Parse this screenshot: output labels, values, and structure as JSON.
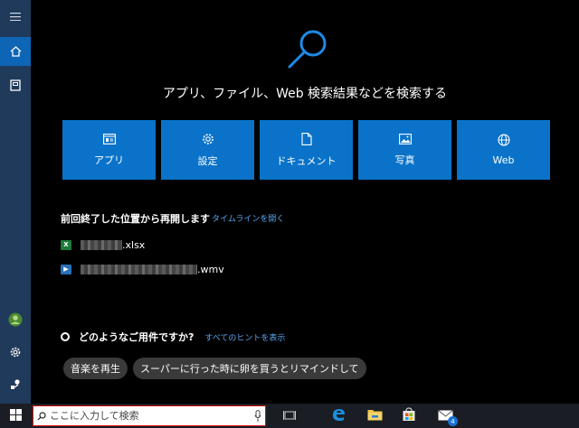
{
  "hero": {
    "text": "アプリ、ファイル、Web 検索結果などを検索する"
  },
  "tiles": [
    {
      "label": "アプリ",
      "icon": "app-window-icon"
    },
    {
      "label": "設定",
      "icon": "gear-icon"
    },
    {
      "label": "ドキュメント",
      "icon": "document-icon"
    },
    {
      "label": "写真",
      "icon": "image-icon"
    },
    {
      "label": "Web",
      "icon": "globe-icon"
    }
  ],
  "resume": {
    "title": "前回終了した位置から再開します",
    "timeline_link": "タイムラインを開く",
    "files": [
      {
        "ext": ".xlsx",
        "icon": "excel-file-icon",
        "color": "#1d7a3a"
      },
      {
        "ext": ".wmv",
        "icon": "video-file-icon",
        "color": "#2a6fb8"
      }
    ]
  },
  "hint": {
    "question": "どのようなご用件ですか?",
    "link": "すべてのヒントを表示"
  },
  "suggestions": [
    "音楽を再生",
    "スーパーに行った時に卵を買うとリマインドして"
  ],
  "taskbar": {
    "search_placeholder": "ここに入力して検索",
    "mail_badge": "4"
  },
  "colors": {
    "accent": "#0a73c9",
    "rail": "#1f3a5a",
    "link": "#5aa6ef"
  }
}
